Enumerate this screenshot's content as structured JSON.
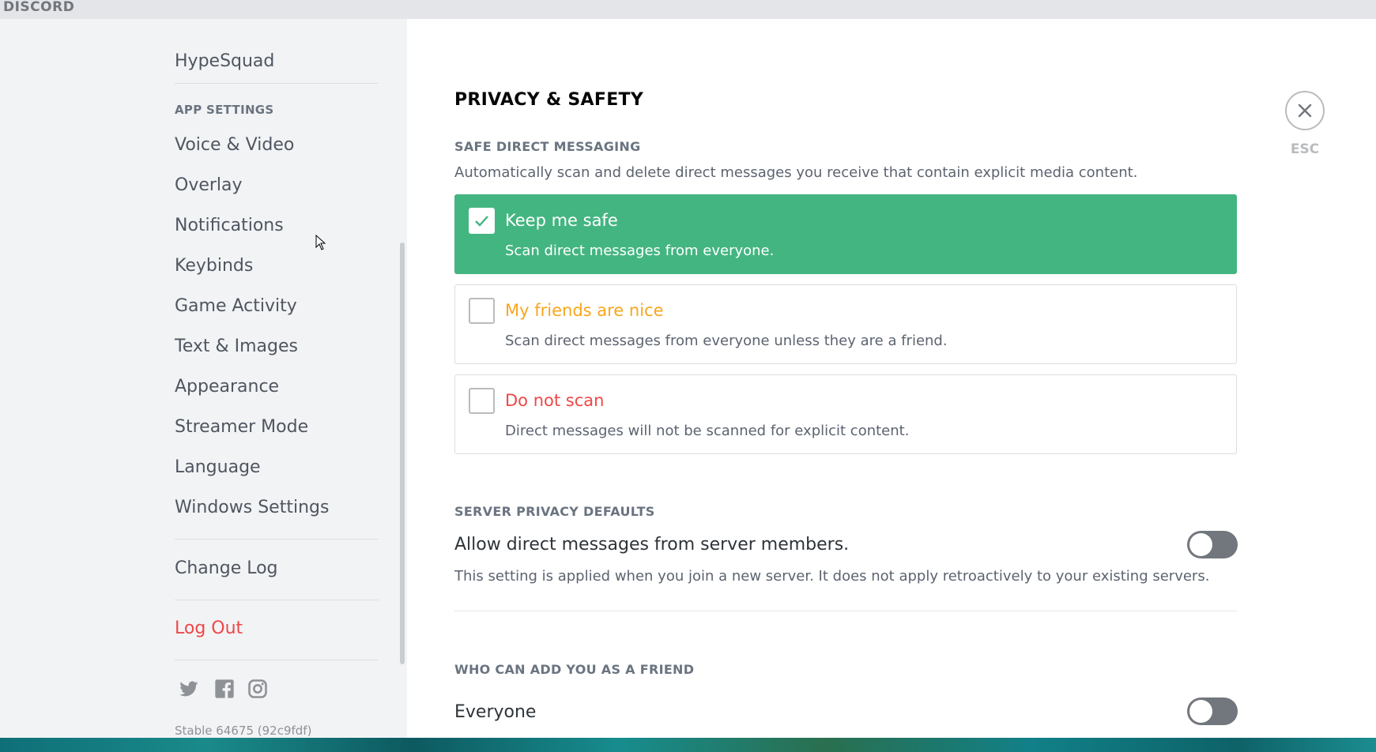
{
  "app": {
    "logo": "DISCORD"
  },
  "sidebar": {
    "hypesquad": "HypeSquad",
    "app_settings_header": "APP SETTINGS",
    "items": [
      "Voice & Video",
      "Overlay",
      "Notifications",
      "Keybinds",
      "Game Activity",
      "Text & Images",
      "Appearance",
      "Streamer Mode",
      "Language",
      "Windows Settings"
    ],
    "change_log": "Change Log",
    "log_out": "Log Out",
    "social_icons": [
      "twitter-icon",
      "facebook-icon",
      "instagram-icon"
    ],
    "version": "Stable 64675 (92c9fdf)"
  },
  "page": {
    "title": "PRIVACY & SAFETY",
    "esc_label": "ESC",
    "safe_dm": {
      "header": "SAFE DIRECT MESSAGING",
      "description": "Automatically scan and delete direct messages you receive that contain explicit media content.",
      "options": [
        {
          "title": "Keep me safe",
          "description": "Scan direct messages from everyone.",
          "selected": true
        },
        {
          "title": "My friends are nice",
          "description": "Scan direct messages from everyone unless they are a friend.",
          "selected": false
        },
        {
          "title": "Do not scan",
          "description": "Direct messages will not be scanned for explicit content.",
          "selected": false
        }
      ]
    },
    "server_privacy": {
      "header": "SERVER PRIVACY DEFAULTS",
      "setting_title": "Allow direct messages from server members.",
      "setting_description": "This setting is applied when you join a new server. It does not apply retroactively to your existing servers.",
      "enabled": false
    },
    "friend_requests": {
      "header": "WHO CAN ADD YOU AS A FRIEND",
      "setting_title": "Everyone",
      "enabled": false
    }
  },
  "colors": {
    "selected_green": "#43b581",
    "orange": "#faa61a",
    "red": "#f04747",
    "toggle_off": "#72767d"
  }
}
